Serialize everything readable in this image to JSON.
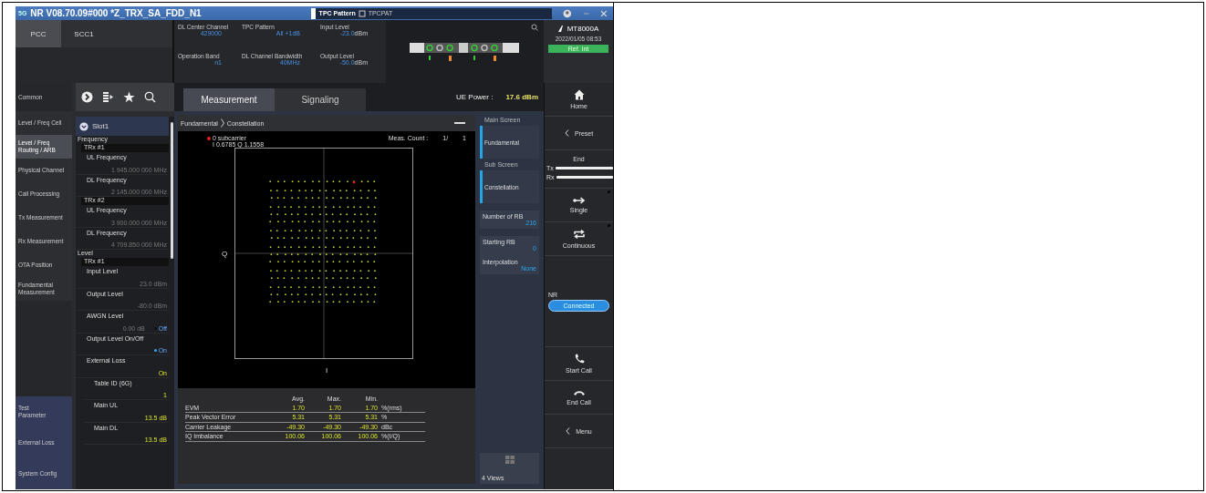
{
  "window": {
    "badge": "5G",
    "title": "NR V08.70.09#000  *Z_TRX_SA_FDD_N1",
    "tpc_label": "TPC Pattern",
    "tpc_value": "TPCPAT"
  },
  "carrier_tabs": [
    {
      "label": "PCC",
      "selected": true
    },
    {
      "label": "SCC1",
      "selected": false
    }
  ],
  "params": [
    {
      "label": "DL Center Channel",
      "value": "429000"
    },
    {
      "label": "TPC Pattern",
      "value": "All +1dB"
    },
    {
      "label": "Input Level",
      "value": "-23.0",
      "unit": "dBm"
    },
    {
      "label": "Operation Band",
      "value": "n1"
    },
    {
      "label": "DL Channel Bandwidth",
      "value": "40MHz"
    },
    {
      "label": "Output Level",
      "value": "-50.0",
      "unit": "dBm"
    }
  ],
  "instrument": {
    "model": "MT8000A",
    "datetime": "2022/01/05 08:53",
    "reference": "Ref. Int"
  },
  "nav": [
    {
      "label": "Common",
      "selected": false
    },
    {
      "label": "Level / Freq Cell",
      "selected": false
    },
    {
      "label": "Level / Freq Routing / ARB",
      "selected": true
    },
    {
      "label": "Physical Channel",
      "selected": false
    },
    {
      "label": "Call Processing",
      "selected": false
    },
    {
      "label": "Tx Measurement",
      "selected": false
    },
    {
      "label": "Rx Measurement",
      "selected": false
    },
    {
      "label": "OTA Position",
      "selected": false
    },
    {
      "label": "Fundamental Measurement",
      "selected": false
    }
  ],
  "nav_bottom": [
    {
      "label": "Test Parameter"
    },
    {
      "label": "External Loss"
    },
    {
      "label": "System Config"
    }
  ],
  "tree": [
    {
      "kind": "slot",
      "label": "Slot1",
      "expanded": true,
      "children": [
        {
          "kind": "section",
          "label": "Frequency",
          "children": [
            {
              "kind": "group",
              "label": "TRx #1",
              "children": [
                {
                  "kind": "param",
                  "label": "UL Frequency",
                  "value": "1 945.000 000 MHz"
                },
                {
                  "kind": "param",
                  "label": "DL Frequency",
                  "value": "2 145.000 000 MHz"
                }
              ]
            },
            {
              "kind": "group",
              "label": "TRx #2",
              "children": [
                {
                  "kind": "param",
                  "label": "UL Frequency",
                  "value": "3 900.000 000 MHz"
                },
                {
                  "kind": "param",
                  "label": "DL Frequency",
                  "value": "4 709.850 000 MHz"
                }
              ]
            }
          ]
        },
        {
          "kind": "section",
          "label": "Level",
          "children": [
            {
              "kind": "group",
              "label": "TRx #1",
              "children": [
                {
                  "kind": "param",
                  "label": "Input Level",
                  "value": "23.0 dBm"
                },
                {
                  "kind": "param",
                  "label": "Output Level",
                  "value": "-80.0 dBm"
                },
                {
                  "kind": "switch",
                  "label": "AWGN Level",
                  "value": "0.00 dB",
                  "switch_label": "Off",
                  "on": false
                },
                {
                  "kind": "switch",
                  "label": "Output Level On/Off",
                  "switch_label": "On",
                  "on": true
                },
                {
                  "kind": "param",
                  "label": "External Loss",
                  "value": "On",
                  "children": [
                    {
                      "kind": "param",
                      "label": "Table ID (6G)",
                      "value": "1"
                    },
                    {
                      "kind": "param",
                      "label": "Main UL",
                      "value": "13.5 dB"
                    },
                    {
                      "kind": "param",
                      "label": "Main DL",
                      "value": "13.5 dB"
                    }
                  ]
                }
              ]
            }
          ]
        }
      ]
    }
  ],
  "main_tabs": [
    {
      "label": "Measurement",
      "selected": true
    },
    {
      "label": "Signaling",
      "selected": false
    }
  ],
  "ue_power": {
    "label": "UE Power :",
    "value": "17.6 dBm"
  },
  "breadcrumb": [
    "Fundamental",
    "Constellation"
  ],
  "marker": {
    "label": "0 subcarrier",
    "reading": "I 0.6785 Q 1.1558"
  },
  "meas_count": {
    "label": "Meas. Count :",
    "value": "1/",
    "total": "1"
  },
  "axes": {
    "y": "Q",
    "x": "I"
  },
  "results": {
    "columns": [
      "Avg.",
      "Max.",
      "Min."
    ],
    "rows": [
      {
        "name": "EVM",
        "avg": "1.70",
        "max": "1.70",
        "min": "1.70",
        "unit": "%(rms)"
      },
      {
        "name": "Peak Vector Error",
        "avg": "5.31",
        "max": "5.31",
        "min": "5.31",
        "unit": "%"
      },
      {
        "name": "Carrier Leakage",
        "avg": "-49.30",
        "max": "-49.30",
        "min": "-49.30",
        "unit": "dBc"
      },
      {
        "name": "IQ Imbalance",
        "avg": "100.06",
        "max": "100.06",
        "min": "100.06",
        "unit": "%(I/Q)"
      }
    ]
  },
  "options": [
    {
      "kind": "screen",
      "heading": "Main Screen",
      "label": "Fundamental"
    },
    {
      "kind": "screen",
      "heading": "Sub Screen",
      "label": "Constellation"
    },
    {
      "kind": "card",
      "items": [
        {
          "label": "Number of RB",
          "value": "216"
        }
      ]
    },
    {
      "kind": "card",
      "items": [
        {
          "label": "Starting RB",
          "value": "0"
        },
        {
          "label": "Interpolation",
          "value": "None"
        }
      ]
    }
  ],
  "views_button": "4 Views",
  "softkeys": [
    {
      "kind": "home",
      "label": "Home"
    },
    {
      "kind": "back",
      "label": "Preset"
    },
    {
      "kind": "end",
      "label": "End",
      "tx": "Tx",
      "rx": "Rx"
    },
    {
      "kind": "single",
      "label": "Single"
    },
    {
      "kind": "continuous",
      "label": "Continuous"
    },
    {
      "kind": "status",
      "label": "NR",
      "value": "Connected"
    },
    {
      "kind": "start-call",
      "label": "Start Call"
    },
    {
      "kind": "end-call",
      "label": "End Call"
    },
    {
      "kind": "back",
      "label": "Menu"
    }
  ]
}
